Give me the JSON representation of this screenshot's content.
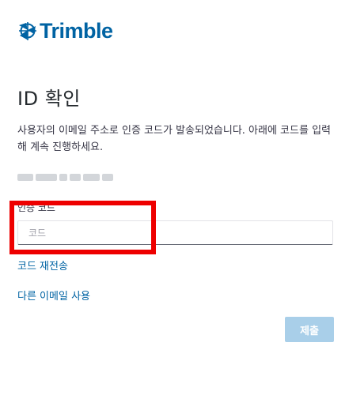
{
  "brand": {
    "logo_text": "Trimble",
    "color": "#0063a3"
  },
  "page": {
    "title": "ID 확인",
    "instructions": "사용자의 이메일 주소로 인증 코드가 발송되었습니다. 아래에 코드를 입력해 계속 진행하세요."
  },
  "code_field": {
    "label": "인증 코드",
    "placeholder": "코드",
    "value": ""
  },
  "links": {
    "resend": "코드 재전송",
    "use_other_email": "다른 이메일 사용"
  },
  "actions": {
    "submit_label": "제출",
    "submit_color": "#a9cfe9"
  },
  "highlight_color": "#ee0000"
}
